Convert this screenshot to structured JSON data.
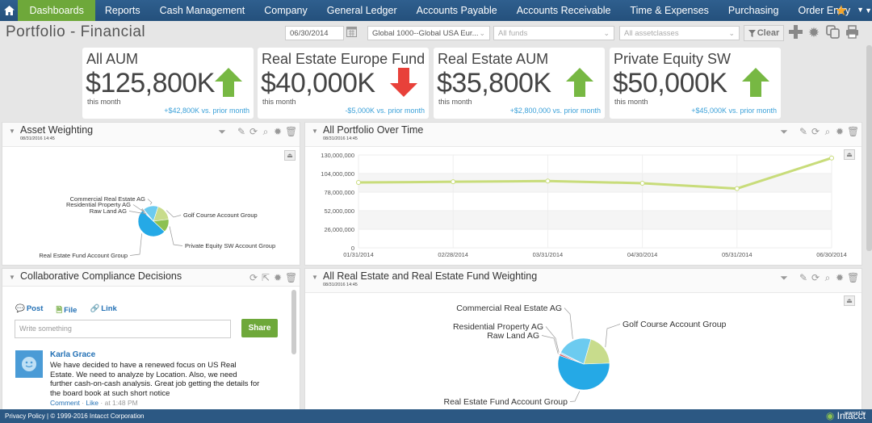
{
  "nav": {
    "home_icon": "home-icon",
    "items": [
      "Dashboards",
      "Reports",
      "Cash Management",
      "Company",
      "General Ledger",
      "Accounts Payable",
      "Accounts Receivable",
      "Time & Expenses",
      "Purchasing",
      "Order Entry"
    ],
    "active": "Dashboards"
  },
  "page": {
    "title": "Portfolio - Financial",
    "date_value": "06/30/2014",
    "entity_value": "Global 1000--Global USA Eur...",
    "funds_placeholder": "All funds",
    "assetclasses_placeholder": "All assetclasses",
    "clear_label": "Clear"
  },
  "kpis": [
    {
      "label": "All AUM",
      "value": "$125,800K",
      "sub": "this month",
      "change": "+$42,800K vs. prior month",
      "direction": "up"
    },
    {
      "label": "Real Estate Europe Fund",
      "value": "$40,000K",
      "sub": "this month",
      "change": "-$5,000K vs. prior month",
      "direction": "down"
    },
    {
      "label": "Real Estate AUM",
      "value": "$35,800K",
      "sub": "this month",
      "change": "+$2,800,000 vs. prior month",
      "direction": "up"
    },
    {
      "label": "Private Equity SW",
      "value": "$50,000K",
      "sub": "this month",
      "change": "+$45,000K vs. prior month",
      "direction": "up"
    }
  ],
  "colors": {
    "up": "#77b843",
    "down": "#e8413a",
    "accent": "#6ea83a",
    "nav": "#2a5785",
    "line": "#c8dc7a"
  },
  "panels": {
    "asset_weighting": {
      "title": "Asset Weighting",
      "date": "08/31/2016 14:45"
    },
    "portfolio_time": {
      "title": "All Portfolio Over Time",
      "date": "08/31/2016 14:45"
    },
    "compliance": {
      "title": "Collaborative Compliance Decisions"
    },
    "re_weighting": {
      "title": "All Real Estate and Real Estate Fund Weighting",
      "date": "08/31/2016 14:45"
    }
  },
  "compliance": {
    "tabs": [
      "Post",
      "File",
      "Link"
    ],
    "placeholder": "Write something",
    "share_label": "Share",
    "post": {
      "author": "Karla Grace",
      "text": "We have decided to have a renewed focus on US Real Estate. We need to analyze by Location. Also, we need further cash-on-cash analysis. Great job getting the details for the board book at such short notice",
      "comment": "Comment",
      "like": "Like",
      "time": "at 1:48 PM"
    }
  },
  "footer": {
    "text": "Privacy Policy | © 1999-2016  Intacct Corporation",
    "brand": "Intacct",
    "powered": "powered by"
  },
  "chart_data": [
    {
      "type": "pie",
      "title": "Asset Weighting",
      "categories": [
        "Golf Course Account Group",
        "Private Equity SW Account Group",
        "Real Estate Fund Account Group",
        "Raw Land AG",
        "Residential Property AG",
        "Commercial Real Estate AG"
      ],
      "values": [
        18,
        14,
        50,
        1,
        1,
        16
      ],
      "colors": [
        "#c8dc8c",
        "#8cc152",
        "#25a9e6",
        "#e05050",
        "#b0d0e8",
        "#6ccbf0"
      ]
    },
    {
      "type": "line",
      "title": "All Portfolio Over Time",
      "x": [
        "01/31/2014",
        "02/28/2014",
        "03/31/2014",
        "04/30/2014",
        "05/31/2014",
        "06/30/2014"
      ],
      "series": [
        {
          "name": "All Portfolio",
          "values": [
            91500000,
            92500000,
            93500000,
            90500000,
            83000000,
            125800000
          ]
        }
      ],
      "yticks": [
        0,
        26000000,
        52000000,
        78000000,
        104000000,
        130000000
      ],
      "yticklabels": [
        "0",
        "26,000,000",
        "52,000,000",
        "78,000,000",
        "104,000,000",
        "130,000,000"
      ],
      "ylim": [
        0,
        130000000
      ],
      "grid": true
    },
    {
      "type": "pie",
      "title": "All Real Estate and Real Estate Fund Weighting",
      "categories": [
        "Golf Course Account Group",
        "Real Estate Fund Account Group",
        "Raw Land AG",
        "Residential Property AG",
        "Commercial Real Estate AG"
      ],
      "values": [
        20,
        56,
        1,
        1,
        22
      ],
      "colors": [
        "#c8dc8c",
        "#25a9e6",
        "#e05050",
        "#b0d0e8",
        "#6ccbf0"
      ]
    }
  ]
}
